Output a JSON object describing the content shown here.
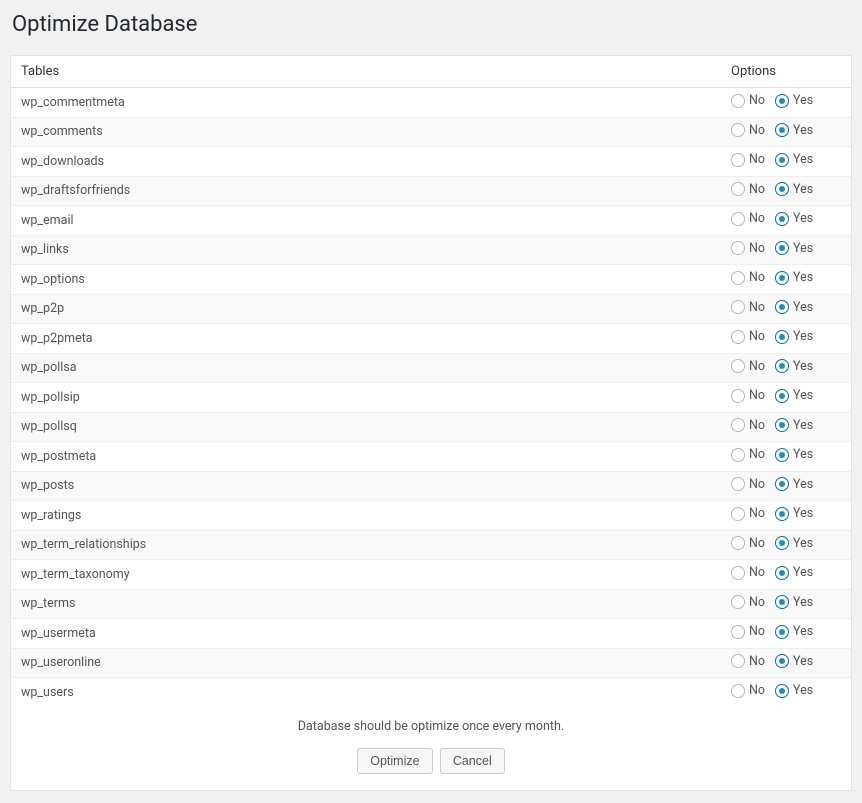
{
  "page": {
    "title": "Optimize Database"
  },
  "table": {
    "headers": {
      "tables": "Tables",
      "options": "Options"
    },
    "labels": {
      "no": "No",
      "yes": "Yes"
    },
    "rows": [
      {
        "name": "wp_commentmeta",
        "selected": "yes"
      },
      {
        "name": "wp_comments",
        "selected": "yes"
      },
      {
        "name": "wp_downloads",
        "selected": "yes"
      },
      {
        "name": "wp_draftsforfriends",
        "selected": "yes"
      },
      {
        "name": "wp_email",
        "selected": "yes"
      },
      {
        "name": "wp_links",
        "selected": "yes"
      },
      {
        "name": "wp_options",
        "selected": "yes"
      },
      {
        "name": "wp_p2p",
        "selected": "yes"
      },
      {
        "name": "wp_p2pmeta",
        "selected": "yes"
      },
      {
        "name": "wp_pollsa",
        "selected": "yes"
      },
      {
        "name": "wp_pollsip",
        "selected": "yes"
      },
      {
        "name": "wp_pollsq",
        "selected": "yes"
      },
      {
        "name": "wp_postmeta",
        "selected": "yes"
      },
      {
        "name": "wp_posts",
        "selected": "yes"
      },
      {
        "name": "wp_ratings",
        "selected": "yes"
      },
      {
        "name": "wp_term_relationships",
        "selected": "yes"
      },
      {
        "name": "wp_term_taxonomy",
        "selected": "yes"
      },
      {
        "name": "wp_terms",
        "selected": "yes"
      },
      {
        "name": "wp_usermeta",
        "selected": "yes"
      },
      {
        "name": "wp_useronline",
        "selected": "yes"
      },
      {
        "name": "wp_users",
        "selected": "yes"
      }
    ]
  },
  "footer": {
    "note": "Database should be optimize once every month.",
    "optimize_label": "Optimize",
    "cancel_label": "Cancel"
  }
}
